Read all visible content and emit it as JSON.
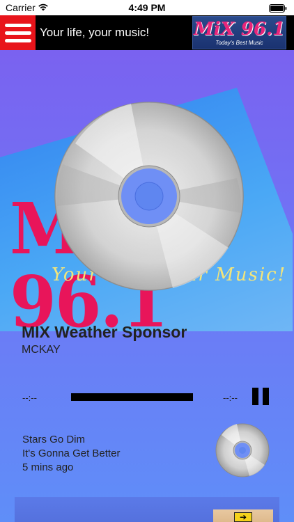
{
  "status_bar": {
    "carrier": "Carrier",
    "time": "4:49 PM"
  },
  "header": {
    "tagline": "Your life, your music!",
    "logo_text": "MiX 96.1",
    "logo_sub": "Today's Best Music",
    "menu_icon": "hamburger-menu-icon"
  },
  "background": {
    "logo_text": "MIX 96.1",
    "logo_sub": "Your Life, Your Music!"
  },
  "now_playing": {
    "title": "MIX Weather Sponsor",
    "artist": "MCKAY",
    "elapsed": "--:--",
    "remaining": "--:--",
    "progress": 1.0
  },
  "previous_track": {
    "title": "Stars Go Dim",
    "song": "It's Gonna Get Better",
    "time_ago": "5 mins ago"
  },
  "colors": {
    "menu_red": "#e8141b",
    "header_black": "#000000",
    "logo_pink": "#e8257a",
    "gradient_top": "#7a62f0",
    "gradient_bottom": "#5f8ef8"
  }
}
